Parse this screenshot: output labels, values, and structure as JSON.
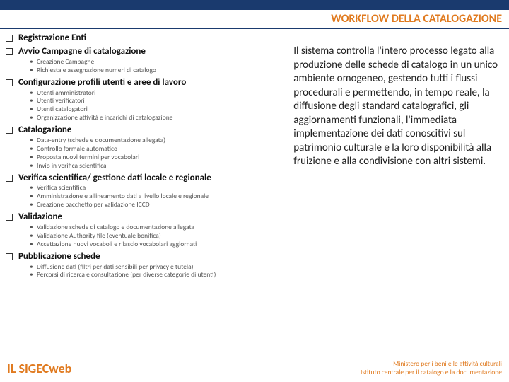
{
  "header": {
    "title": "WORKFLOW DELLA CATALOGAZIONE"
  },
  "sections": [
    {
      "title": "Registrazione Enti",
      "subs": []
    },
    {
      "title": "Avvio Campagne di catalogazione",
      "subs": [
        "Creazione Campagne",
        "Richiesta e assegnazione numeri di catalogo"
      ]
    },
    {
      "title": "Configurazione profili utenti e aree di lavoro",
      "subs": [
        "Utenti amministratori",
        "Utenti verificatori",
        "Utenti catalogatori",
        "Organizzazione attività e incarichi di catalogazione"
      ]
    },
    {
      "title": "Catalogazione",
      "subs": [
        "Data-entry (schede e documentazione allegata)",
        "Controllo formale automatico",
        "Proposta nuovi termini per vocabolari",
        "Invio in verifica scientifica"
      ]
    },
    {
      "title": "Verifica scientifica/ gestione dati locale e regionale",
      "subs": [
        "Verifica scientifica",
        "Amministrazione e allineamento dati a livello locale e regionale",
        "Creazione pacchetto per validazione ICCD"
      ]
    },
    {
      "title": "Validazione",
      "subs": [
        "Validazione schede di catalogo e documentazione allegata",
        "Validazione Authority file (eventuale bonifica)",
        "Accettazione nuovi vocaboli e rilascio vocabolari aggiornati"
      ]
    },
    {
      "title": "Pubblicazione schede",
      "subs": [
        "Diffusione dati (filtri per dati sensibili per privacy e tutela)",
        "Percorsi di ricerca e consultazione (per diverse categorie di utenti)"
      ]
    }
  ],
  "right_text": "Il sistema controlla l'intero processo legato alla produzione delle schede di catalogo in un unico ambiente omogeneo, gestendo tutti i flussi  procedurali e permettendo, in tempo reale, la diffusione degli standard catalografici, gli aggiornamenti funzionali, l'immediata implementazione dei dati conoscitivi sul patrimonio culturale e la loro disponibilità alla fruizione e alla condivisione con altri sistemi.",
  "footer": {
    "left": "IL SIGECweb",
    "right1": "Ministero per i beni e le attività culturali",
    "right2": "Istituto centrale per il catalogo e la documentazione"
  }
}
